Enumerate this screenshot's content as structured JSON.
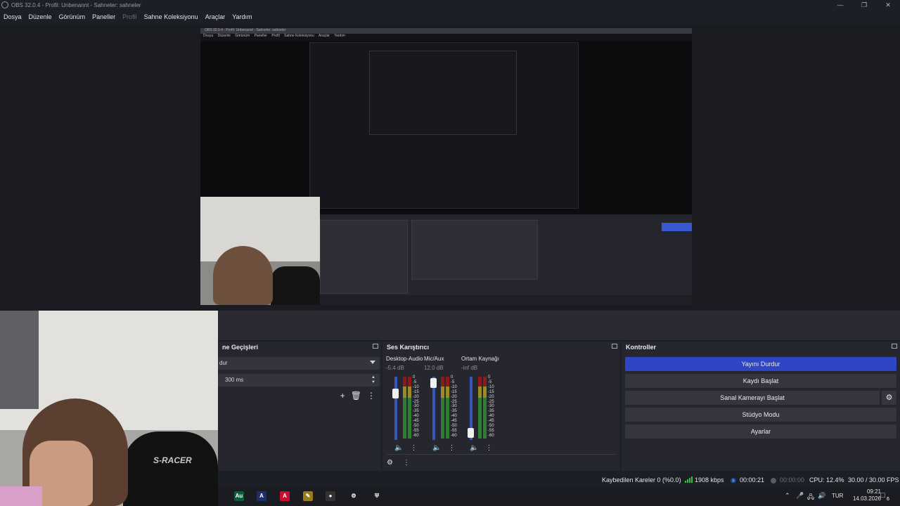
{
  "window": {
    "title": "OBS 32.0.4 - Profil: Unbenannt - Sahneler: sahneler",
    "controls": [
      "—",
      "❐",
      "✕"
    ]
  },
  "menu": [
    {
      "label": "Dosya",
      "disabled": false
    },
    {
      "label": "Düzenle",
      "disabled": false
    },
    {
      "label": "Görünüm",
      "disabled": false
    },
    {
      "label": "Paneller",
      "disabled": false
    },
    {
      "label": "Profil",
      "disabled": true
    },
    {
      "label": "Sahne Koleksiyonu",
      "disabled": false
    },
    {
      "label": "Araçlar",
      "disabled": false
    },
    {
      "label": "Yardım",
      "disabled": false
    }
  ],
  "preview": {
    "inner_title": "OBS 32.0.4 - Profil: Unbenannt - Sahneler: sahneler",
    "inner_menu": [
      "Dosya",
      "Düzenle",
      "Görünüm",
      "Paneller",
      "Profil",
      "Sahne Koleksiyonu",
      "Araçlar",
      "Yardım"
    ],
    "webcam_chair_text": "S-RACER"
  },
  "transitions": {
    "title": "ne Geçişleri",
    "selected": "dur",
    "duration": "300 ms"
  },
  "mixer": {
    "title": "Ses Karıştırıcı",
    "scale": [
      "0",
      "-5",
      "-10",
      "-15",
      "-20",
      "-25",
      "-30",
      "-35",
      "-40",
      "-45",
      "-50",
      "-55",
      "-60"
    ],
    "channels": [
      {
        "name": "Desktop-Audio",
        "db": "-5.4 dB",
        "level": 0.78
      },
      {
        "name": "Mic/Aux",
        "db": "12.0 dB",
        "level": 0.98
      },
      {
        "name": "Ortam Kaynağı",
        "db": "-inf dB",
        "level": 0.04
      }
    ]
  },
  "controls": {
    "title": "Kontroller",
    "stop_stream": "Yayını Durdur",
    "start_record": "Kaydı Başlat",
    "start_virtualcam": "Sanal Kamerayı Başlat",
    "studio_mode": "Stüdyo Modu",
    "settings": "Ayarlar"
  },
  "status": {
    "dropped_frames": "Kaybedilen Kareler 0 (%0.0)",
    "bitrate": "1908 kbps",
    "stream_time": "00:00:21",
    "record_time": "00:00:00",
    "cpu": "CPU: 12.4%",
    "fps": "30.00 / 30.00 FPS"
  },
  "webcam": {
    "chair_text": "S-RACER"
  },
  "taskbar": {
    "apps": [
      {
        "name": "audition",
        "label": "Au",
        "color": "#0a5c3a"
      },
      {
        "name": "affinity-designer",
        "label": "A",
        "color": "#1d2e6b"
      },
      {
        "name": "acrobat",
        "label": "A",
        "color": "#c8102e"
      },
      {
        "name": "pencil-app",
        "label": "✎",
        "color": "#9a7a1a"
      },
      {
        "name": "obs",
        "label": "●",
        "color": "#333333"
      },
      {
        "name": "settings",
        "label": "⚙",
        "color": "#1b1c22"
      },
      {
        "name": "security",
        "label": "⛨",
        "color": "#1b1c22"
      }
    ],
    "language": "TUR",
    "time": "09:21",
    "date": "14.03.2026",
    "notifications": "6"
  }
}
